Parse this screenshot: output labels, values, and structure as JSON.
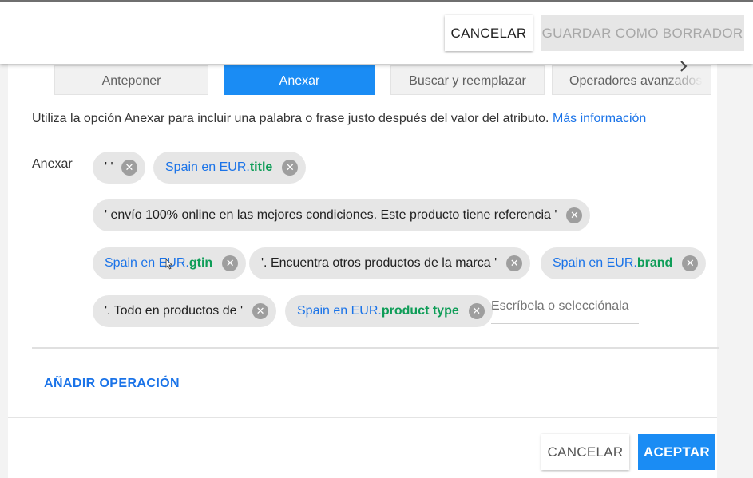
{
  "top_actions": {
    "cancel_label": "CANCELAR",
    "save_draft_label": "GUARDAR COMO BORRADOR"
  },
  "tabs": [
    {
      "label": "Anteponer",
      "active": false
    },
    {
      "label": "Anexar",
      "active": true
    },
    {
      "label": "Buscar y reemplazar",
      "active": false
    },
    {
      "label": "Operadores avanzados",
      "active": false
    }
  ],
  "description": {
    "text": "Utiliza la opción Anexar para incluir una palabra o frase justo después del valor del atributo.",
    "link": "Más información"
  },
  "field": {
    "label": "Anexar",
    "chips": [
      {
        "text": "' '"
      },
      {
        "placeholder": "Spain en EUR.",
        "attribute": "title"
      },
      {
        "text": "' envío 100% online en las mejores condiciones. Este producto tiene referencia '"
      },
      {
        "placeholder": "Spain en EUR.",
        "attribute": "gtin"
      },
      {
        "text": "'. Encuentra otros productos de la marca '"
      },
      {
        "placeholder": "Spain en EUR.",
        "attribute": "brand"
      },
      {
        "text": "'. Todo en productos de '"
      },
      {
        "placeholder": "Spain en EUR.",
        "attribute": "product type"
      }
    ],
    "input_placeholder": "Escríbela o selecciónala"
  },
  "add_operation_label": "AÑADIR OPERACIÓN",
  "bottom_actions": {
    "cancel_label": "CANCELAR",
    "accept_label": "ACEPTAR"
  },
  "colors": {
    "accent": "#1a8cf4",
    "link": "#1a73e8",
    "attribute": "#0f9d58",
    "chip_bg": "#e6e6e6"
  }
}
